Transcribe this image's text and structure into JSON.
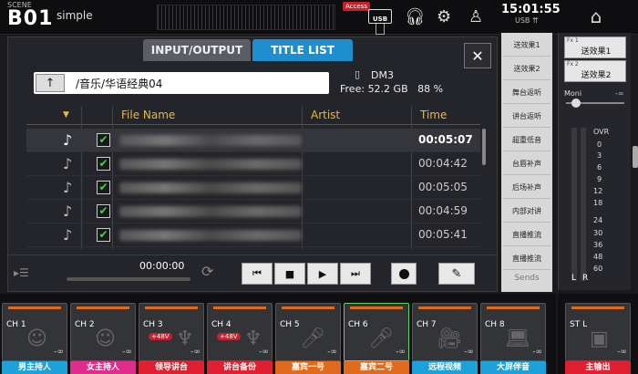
{
  "topbar": {
    "scene_label": "SCENE",
    "scene_number": "B01",
    "scene_name": "simple",
    "access_badge": "Access",
    "usb_label": "USB",
    "clock": "15:01:55",
    "usb_status": "USB ⇈"
  },
  "panel": {
    "tab_io": "INPUT/OUTPUT",
    "tab_titles": "TITLE LIST",
    "close": "✕",
    "up": "↑",
    "path": "/音乐/华语经典04",
    "drive_name": "DM3",
    "free_label": "Free:",
    "free_space": "52.2 GB",
    "free_pct": "88 %",
    "columns": {
      "sort": "▼",
      "file_name": "File Name",
      "artist": "Artist",
      "time": "Time"
    },
    "rows": [
      {
        "time": "00:05:07"
      },
      {
        "time": "00:04:42"
      },
      {
        "time": "00:05:05"
      },
      {
        "time": "00:04:59"
      },
      {
        "time": "00:05:41"
      }
    ],
    "play_time": "00:00:00"
  },
  "sends": {
    "items": [
      "送效果1",
      "送效果2",
      "舞台返听",
      "讲台返听",
      "超重低音",
      "台唇补声",
      "后场补声",
      "内部对讲",
      "直播推流",
      "直播推流"
    ],
    "label": "Sends"
  },
  "right": {
    "fx1_label": "Fx 1",
    "fx1_name": "送效果1",
    "fx2_label": "Fx 2",
    "fx2_name": "送效果2",
    "moni": "Moni",
    "moni_val": "-∞",
    "scale": [
      "OVR",
      "0",
      "3",
      "6",
      "9",
      "12",
      "18",
      "24",
      "30",
      "36",
      "48",
      "60"
    ],
    "l": "L",
    "r": "R"
  },
  "channels": [
    {
      "label": "CH 1",
      "name": "男主持人",
      "color": "#1ea0d8",
      "p48": ""
    },
    {
      "label": "CH 2",
      "name": "女主持人",
      "color": "#e02c8c",
      "p48": ""
    },
    {
      "label": "CH 3",
      "name": "领导讲台",
      "color": "#e02030",
      "p48": "+48V"
    },
    {
      "label": "CH 4",
      "name": "讲台备份",
      "color": "#e02030",
      "p48": "+48V"
    },
    {
      "label": "CH 5",
      "name": "嘉宾一号",
      "color": "#e06b1c",
      "p48": ""
    },
    {
      "label": "CH 6",
      "name": "嘉宾二号",
      "color": "#e06b1c",
      "p48": ""
    },
    {
      "label": "CH 7",
      "name": "远程视频",
      "color": "#1ea0d8",
      "p48": ""
    },
    {
      "label": "CH 8",
      "name": "大屏伴音",
      "color": "#1ea0d8",
      "p48": ""
    },
    {
      "label": "ST L",
      "name": "主输出",
      "color": "#e02030",
      "p48": ""
    }
  ],
  "minus_inf": "-∞"
}
